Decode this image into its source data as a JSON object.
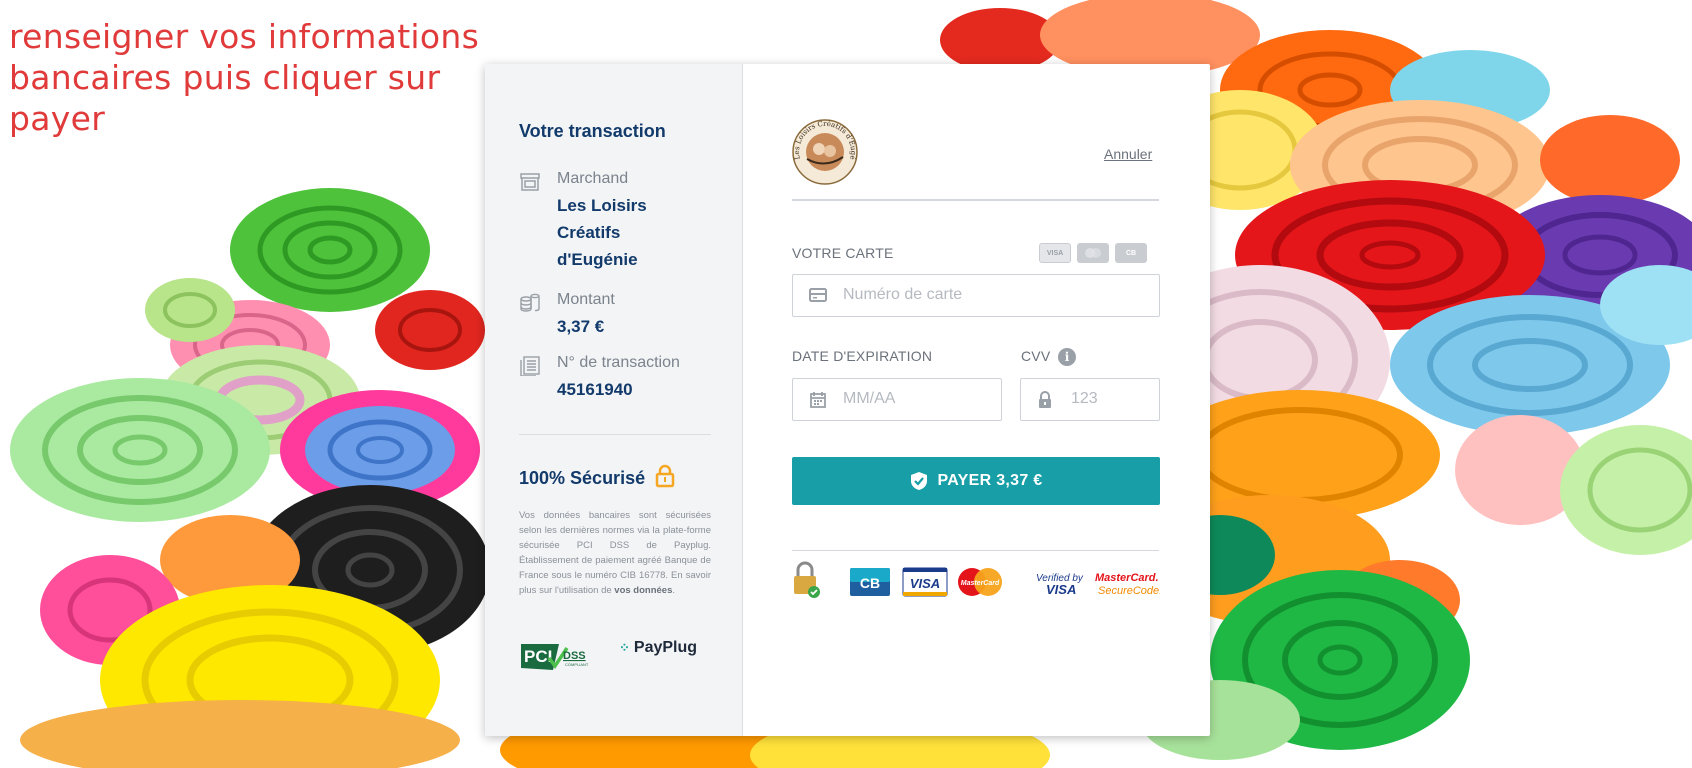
{
  "instruction": "renseigner vos informations bancaires puis cliquer sur payer",
  "sidebar": {
    "title": "Votre transaction",
    "merchant": {
      "label": "Marchand",
      "value": "Les Loisirs Créatifs d'Eugénie"
    },
    "amount": {
      "label": "Montant",
      "value": "3,37 €"
    },
    "transaction": {
      "label": "N° de transaction",
      "value": "45161940"
    },
    "secure_title": "100% Sécurisé",
    "secure_text": "Vos données bancaires sont sécurisées selon les dernières normes via la plate-forme sécurisée PCI DSS de Payplug. Établissement de paiement agréé Banque de France sous le numéro CIB 16778. En savoir plus sur l'utilisation de",
    "secure_link": "vos données",
    "payplug": "PayPlug",
    "pci": "DSS"
  },
  "form": {
    "logo_text": "Les Loisirs Créatifs d'Eugénie",
    "cancel": "Annuler",
    "card_label": "VOTRE CARTE",
    "card_placeholder": "Numéro de carte",
    "expiry_label": "DATE D'EXPIRATION",
    "expiry_placeholder": "MM/AA",
    "cvv_label": "CVV",
    "cvv_placeholder": "123",
    "pay_button": "PAYER 3,37 €",
    "mini_cards": [
      "VISA",
      "MC",
      "CB"
    ]
  },
  "footer_logos": {
    "cb": "CB",
    "visa": "VISA",
    "mastercard": "MasterCard",
    "verified_by": "Verified by",
    "verified_visa": "VISA",
    "mc_secure_top": "MasterCard.",
    "mc_secure_bottom": "SecureCode."
  },
  "colors": {
    "accent": "#179ea6",
    "navy": "#123a6b",
    "instruction": "#e03a3a"
  }
}
